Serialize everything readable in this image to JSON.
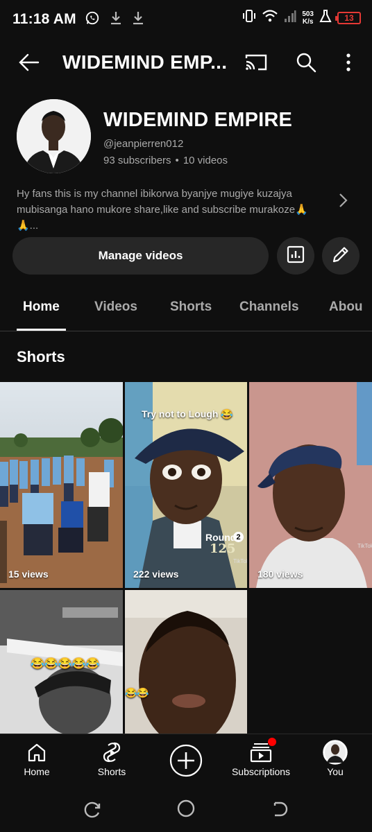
{
  "status_bar": {
    "time": "11:18 AM",
    "net_speed_value": "503",
    "net_speed_unit": "K/s",
    "battery": "13",
    "icons": [
      "whatsapp-icon",
      "download-icon",
      "download-icon",
      "vibrate-icon",
      "wifi-icon",
      "signal-icon",
      "lab-icon",
      "battery-icon"
    ]
  },
  "app_bar": {
    "title": "WIDEMIND EMP...",
    "icons": [
      "back-arrow-icon",
      "cast-icon",
      "search-icon",
      "more-vert-icon"
    ]
  },
  "channel": {
    "name": "WIDEMIND EMPIRE",
    "handle": "@jeanpierren012",
    "subscribers": "93 subscribers",
    "separator": "•",
    "videos": "10 videos",
    "description": "Hy fans this is my channel ibikorwa byanjye mugiye kuzajya mubisanga hano mukore share,like and subscribe murakoze🙏🙏..."
  },
  "actions": {
    "manage_label": "Manage videos",
    "icons": [
      "analytics-icon",
      "edit-pencil-icon"
    ]
  },
  "tabs": [
    {
      "label": "Home",
      "active": true
    },
    {
      "label": "Videos",
      "active": false
    },
    {
      "label": "Shorts",
      "active": false
    },
    {
      "label": "Channels",
      "active": false
    },
    {
      "label": "Abou",
      "active": false
    }
  ],
  "section": {
    "title": "Shorts"
  },
  "shorts": [
    {
      "views": "15 views"
    },
    {
      "views": "222 views",
      "overlay": "Try not to Lough 😂",
      "round_label": "Round",
      "round_badge": "2",
      "score": "125",
      "watermark": "TikTok"
    },
    {
      "views": "180 views",
      "watermark": "TikTok"
    },
    {
      "views": "",
      "overlay": "😂😂😂😂😂"
    },
    {
      "views": "",
      "overlay": "😂😂"
    }
  ],
  "bottom_nav": [
    {
      "label": "Home",
      "icon": "home-icon"
    },
    {
      "label": "Shorts",
      "icon": "shorts-icon"
    },
    {
      "label": "",
      "icon": "create-plus-icon"
    },
    {
      "label": "Subscriptions",
      "icon": "subscriptions-icon",
      "badge": true
    },
    {
      "label": "You",
      "icon": "profile-avatar-icon"
    }
  ],
  "system_nav": [
    "recents-icon",
    "home-circle-icon",
    "back-icon"
  ],
  "colors": {
    "background": "#0f0f0f",
    "surface": "#272727",
    "secondary_text": "#aaaaaa",
    "badge_red": "#ff0000",
    "battery_red": "#e53935"
  }
}
